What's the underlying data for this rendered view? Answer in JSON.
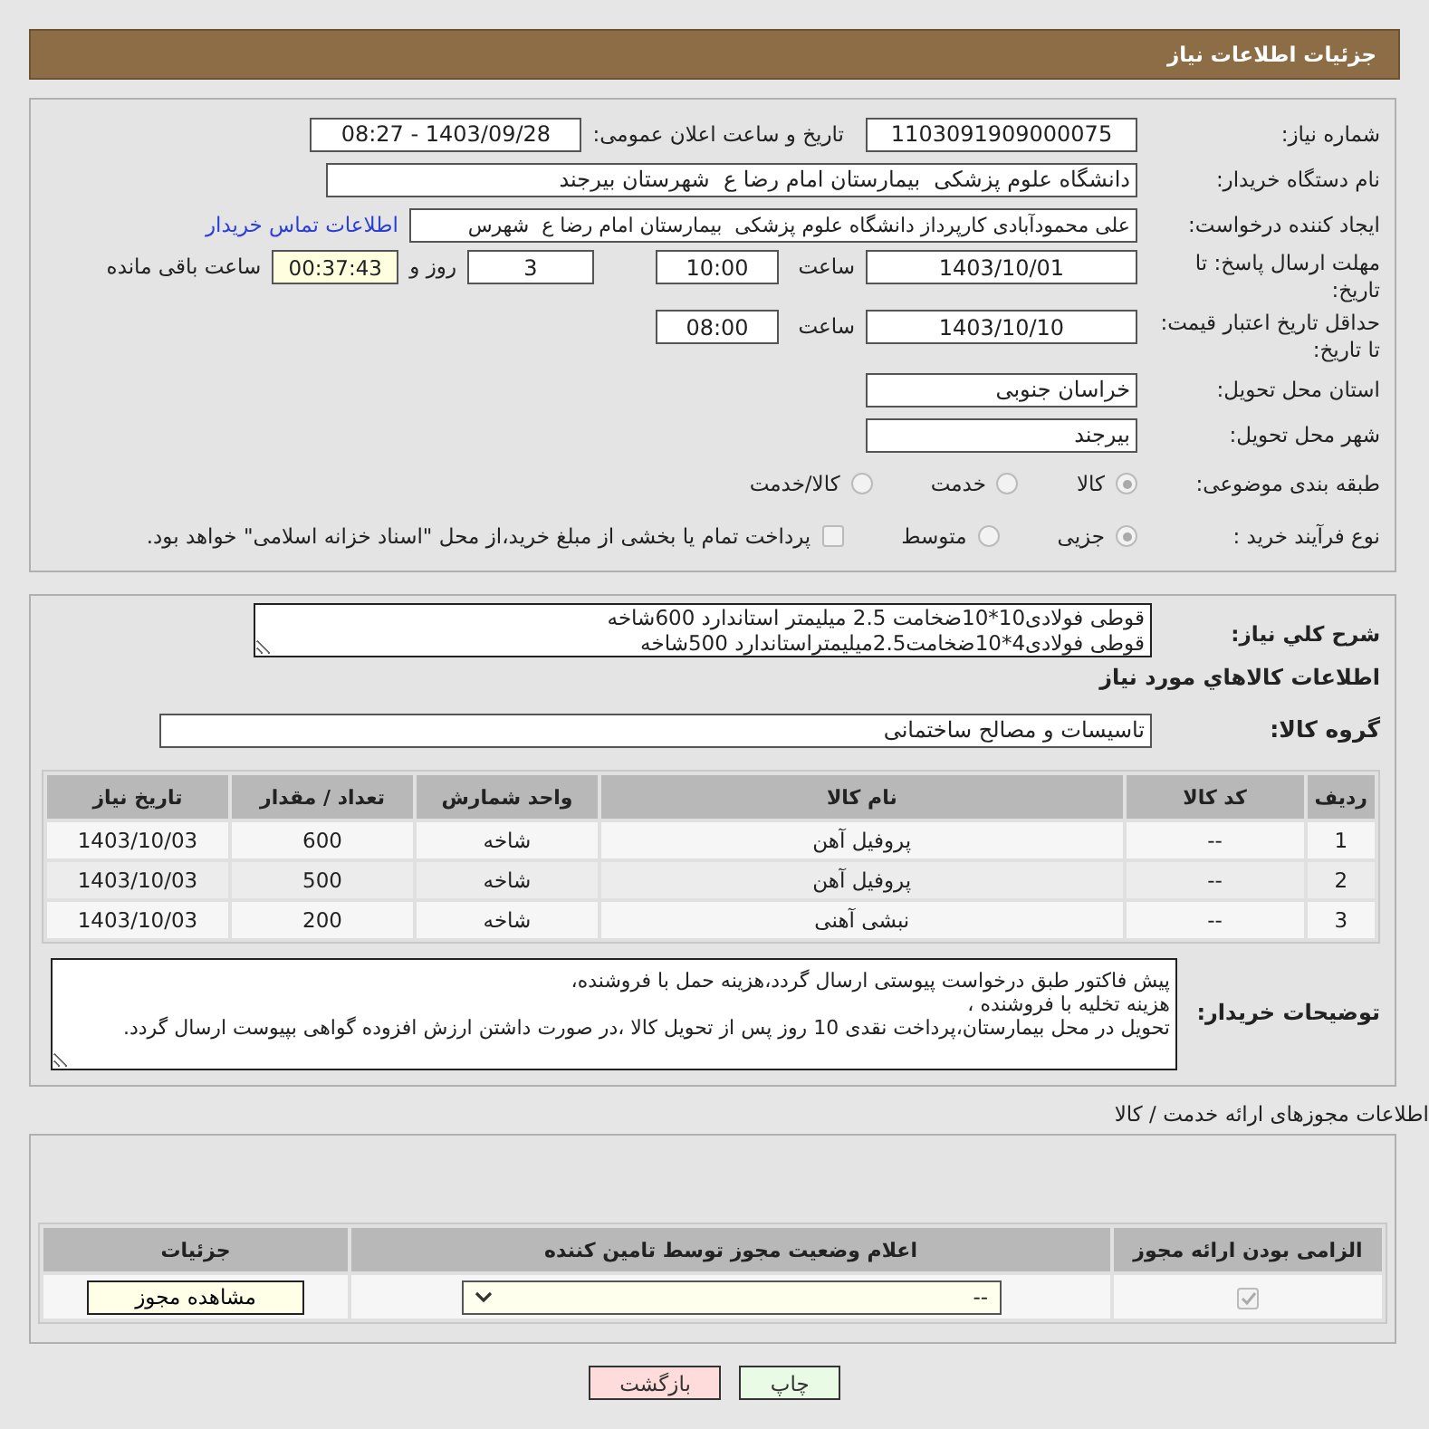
{
  "header": {
    "title": "جزئیات اطلاعات نیاز"
  },
  "form": {
    "need_number": {
      "label": "شماره نیاز:",
      "value": "1103091909000075"
    },
    "announce_datetime": {
      "label": "تاریخ و ساعت اعلان عمومی:",
      "value": "1403/09/28 - 08:27"
    },
    "buyer_org": {
      "label": "نام دستگاه خریدار:",
      "value": "دانشگاه علوم پزشکی  بیمارستان امام رضا ع  شهرستان بیرجند"
    },
    "requester": {
      "label": "ایجاد کننده درخواست:",
      "value": "علی محمودآبادی کارپرداز دانشگاه علوم پزشکی  بیمارستان امام رضا ع  شهرس"
    },
    "contact_link": "اطلاعات تماس خریدار",
    "response_deadline": {
      "label": "مهلت ارسال پاسخ: تا تاریخ:",
      "date": "1403/10/01",
      "time_label": "ساعت",
      "time": "10:00",
      "days": "3",
      "days_label": "روز و",
      "remaining": "00:37:43",
      "remaining_label": "ساعت باقی مانده"
    },
    "price_validity": {
      "label": "حداقل تاریخ اعتبار قیمت: تا تاریخ:",
      "date": "1403/10/10",
      "time_label": "ساعت",
      "time": "08:00"
    },
    "province": {
      "label": "استان محل تحویل:",
      "value": "خراسان جنوبی"
    },
    "city": {
      "label": "شهر محل تحویل:",
      "value": "بیرجند"
    },
    "category": {
      "label": "طبقه بندی موضوعی:",
      "options": [
        {
          "label": "کالا",
          "selected": true
        },
        {
          "label": "خدمت",
          "selected": false
        },
        {
          "label": "کالا/خدمت",
          "selected": false
        }
      ]
    },
    "purchase_type": {
      "label": "نوع فرآیند خرید :",
      "options": [
        {
          "label": "جزیی",
          "selected": true
        },
        {
          "label": "متوسط",
          "selected": false
        }
      ],
      "payment_note": {
        "label": "پرداخت تمام یا بخشی از مبلغ خرید،از محل \"اسناد خزانه اسلامی\" خواهد بود.",
        "checked": false
      }
    }
  },
  "needs": {
    "summary_label": "شرح کلي نياز:",
    "summary": "قوطی فولادی10*10ضخامت 2.5 میلیمتر استاندارد 600شاخه\nقوطی فولادی4*10ضخامت2.5میلیمتراستاندارد 500شاخه",
    "items_heading": "اطلاعات کالاهاي مورد نياز",
    "group_label": "گروه کالا:",
    "group": "تاسیسات و مصالح ساختمانی",
    "table": {
      "columns": [
        "ردیف",
        "کد کالا",
        "نام کالا",
        "واحد شمارش",
        "تعداد / مقدار",
        "تاریخ نیاز"
      ],
      "rows": [
        [
          "1",
          "--",
          "پروفیل آهن",
          "شاخه",
          "600",
          "1403/10/03"
        ],
        [
          "2",
          "--",
          "پروفیل آهن",
          "شاخه",
          "500",
          "1403/10/03"
        ],
        [
          "3",
          "--",
          "نبشی آهنی",
          "شاخه",
          "200",
          "1403/10/03"
        ]
      ]
    },
    "notes_label": "توضیحات خریدار:",
    "notes": "پیش فاکتور طبق درخواست پیوستی ارسال گردد،هزینه حمل با فروشنده،\nهزینه تخلیه با فروشنده ،\nتحویل در محل بیمارستان،پرداخت نقدی 10 روز پس از تحویل کالا ،در صورت داشتن ارزش افزوده گواهی بپیوست ارسال گردد."
  },
  "permits": {
    "title": "اطلاعات مجوزهای ارائه خدمت / کالا",
    "columns": [
      "الزامی بودن ارائه مجوز",
      "اعلام وضعیت مجوز توسط تامین کننده",
      "جزئیات"
    ],
    "rows": [
      {
        "required": true,
        "status": "--",
        "details_button": "مشاهده مجوز"
      }
    ]
  },
  "buttons": [
    {
      "label": "چاپ",
      "kind": "print"
    },
    {
      "label": "بازگشت",
      "kind": "back"
    }
  ]
}
